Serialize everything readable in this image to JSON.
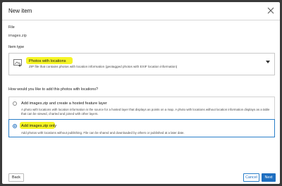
{
  "dialog": {
    "title": "New item",
    "close_icon": "close-icon"
  },
  "file": {
    "label": "File",
    "value": "images.zip"
  },
  "item_type": {
    "label": "Item type",
    "icon": "photo-location-icon",
    "name": "Photos with locations",
    "description": "ZIP file that contains photos with location information (geotagged photos with EXIF location information)",
    "dropdown_icon": "caret-down-icon"
  },
  "question": "How would you like to add this photos with locations?",
  "options": [
    {
      "title": "Add images.zip and create a hosted feature layer",
      "description": "A photo with locations with location information is the source for a hosted layer that displays as points on a map. A photo with locations without location information displays as a table that can be viewed, charted and joined with other layers.",
      "selected": false
    },
    {
      "title": "Add images.zip only",
      "description": "Add photos with locations without publishing. File can be shared and downloaded by others or published at a later date.",
      "selected": true
    }
  ],
  "footer": {
    "back_label": "Back",
    "cancel_label": "Cancel",
    "next_label": "Next"
  },
  "colors": {
    "accent": "#1f6fc0",
    "highlight": "#f3f200"
  }
}
